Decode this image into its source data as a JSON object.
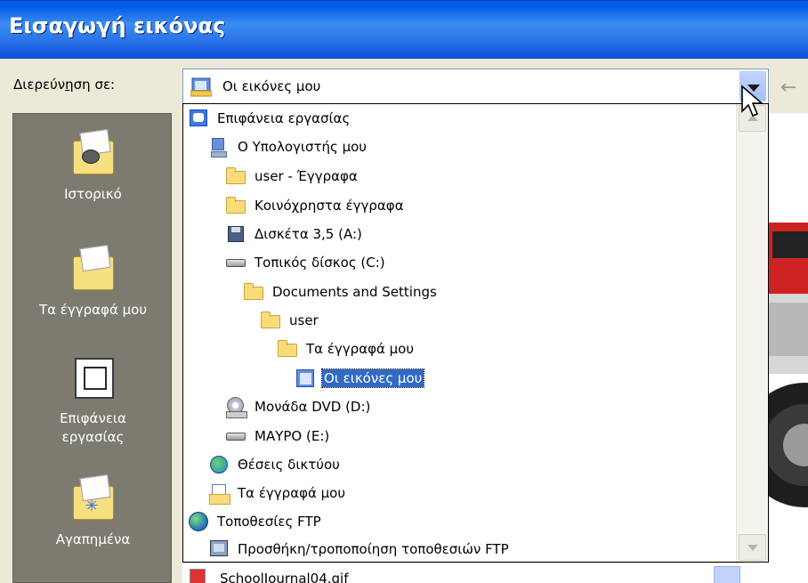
{
  "window": {
    "title": "Εισαγωγή εικόνας"
  },
  "lookin": {
    "label_prefix": "Διερεύν",
    "label_accel": "η",
    "label_suffix": "ση σε:",
    "current": "Οι εικόνες μου"
  },
  "places": [
    {
      "label": "Ιστορικό",
      "icon": "history-folder-icon"
    },
    {
      "label": "Τα έγγραφά μου",
      "icon": "my-documents-folder-icon"
    },
    {
      "label_line1": "Επιφάνεια",
      "label_line2": "εργασίας",
      "icon": "desktop-icon"
    },
    {
      "label": "Αγαπημένα",
      "icon": "favorites-folder-icon"
    }
  ],
  "dropdown": {
    "items": [
      {
        "label": "Επιφάνεια εργασίας",
        "icon": "desktop-icon"
      },
      {
        "label": "Ο Υπολογιστής μου",
        "icon": "my-computer-icon"
      },
      {
        "label": "user - Έγγραφα",
        "icon": "folder-icon"
      },
      {
        "label": "Κοινόχρηστα έγγραφα",
        "icon": "folder-icon"
      },
      {
        "label": "Δισκέτα 3,5 (A:)",
        "icon": "floppy-drive-icon"
      },
      {
        "label": "Τοπικός δίσκος (C:)",
        "icon": "hard-drive-icon"
      },
      {
        "label": "Documents and Settings",
        "icon": "folder-icon"
      },
      {
        "label": "user",
        "icon": "folder-icon"
      },
      {
        "label": "Τα έγγραφά μου",
        "icon": "folder-icon"
      },
      {
        "label": "Οι εικόνες μου",
        "icon": "my-pictures-icon",
        "selected": true
      },
      {
        "label": "Μονάδα DVD (D:)",
        "icon": "dvd-drive-icon"
      },
      {
        "label": "ΜΑΥΡΟ (E:)",
        "icon": "removable-drive-icon"
      },
      {
        "label": "Θέσεις δικτύου",
        "icon": "network-places-icon"
      },
      {
        "label": "Τα έγγραφά μου",
        "icon": "my-documents-icon"
      },
      {
        "label": "Τοποθεσίες FTP",
        "icon": "ftp-locations-icon"
      },
      {
        "label": "Προσθήκη/τροποποίηση τοποθεσιών FTP",
        "icon": "add-ftp-icon"
      }
    ]
  },
  "filelist": {
    "partial_item": "SchoolJournal04.gif"
  },
  "colors": {
    "title_bar": "#2a73e8",
    "selection": "#316ac5",
    "places_bar": "#7d7b6f"
  }
}
